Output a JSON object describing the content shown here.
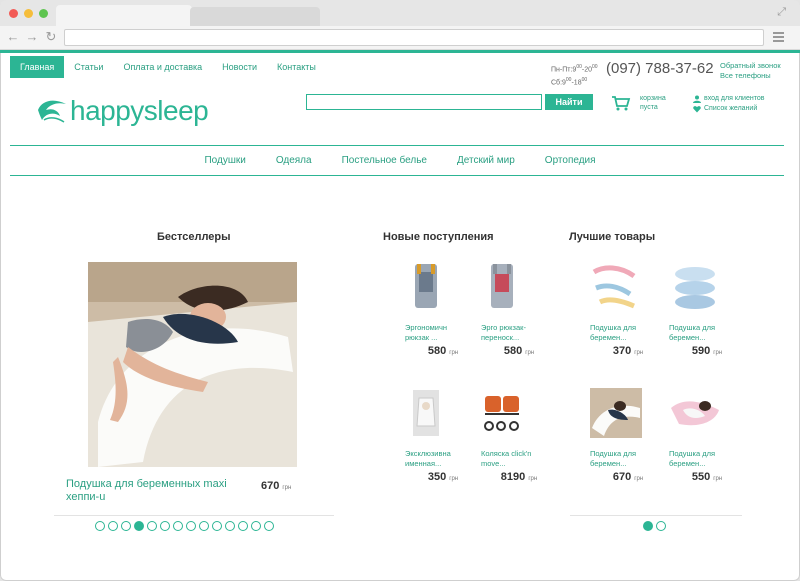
{
  "browser": {
    "colors": {
      "close": "#f25b56",
      "minimize": "#f5bd3a",
      "maximize": "#5ec44f"
    }
  },
  "site": {
    "accent": "#2cb594",
    "topnav": [
      {
        "label": "Главная",
        "active": true
      },
      {
        "label": "Статьи"
      },
      {
        "label": "Оплата и доставка"
      },
      {
        "label": "Новости"
      },
      {
        "label": "Контакты"
      }
    ],
    "hours": {
      "weekdays": "Пн-Пт:9",
      "weekdays_sup1": "00",
      "weekdays_mid": "-20",
      "weekdays_sup2": "00",
      "saturday": "Сб:9",
      "saturday_sup1": "00",
      "saturday_mid": "-18",
      "saturday_sup2": "00"
    },
    "phone": "(097) 788-37-62",
    "callback": "Обратный звонок",
    "all_phones": "Все телефоны",
    "logo": "happysleep",
    "search": {
      "value": "",
      "button": "Найти"
    },
    "cart": {
      "line1": "корзина",
      "line2": "пуста"
    },
    "account": {
      "login": "вход для клиентов",
      "wishlist": "Список желаний"
    },
    "categories": [
      "Подушки",
      "Одеяла",
      "Постельное белье",
      "Детский мир",
      "Ортопедия"
    ]
  },
  "bestsellers": {
    "title": "Бестселлеры",
    "product": {
      "name": "Подушка для беременных maxi хеппи-u",
      "price": "670",
      "currency": "грн"
    },
    "pager_count": 14,
    "pager_active": 3
  },
  "new_arrivals": {
    "title": "Новые поступления",
    "products": [
      {
        "name": "Эргономичн рюкзак ...",
        "price": "580",
        "currency": "грн"
      },
      {
        "name": "Эрго рюкзак-переноск...",
        "price": "580",
        "currency": "грн"
      },
      {
        "name": "Эксклюзивна именная...",
        "price": "350",
        "currency": "грн"
      },
      {
        "name": "Коляска click'n move...",
        "price": "8190",
        "currency": "грн"
      }
    ]
  },
  "best_products": {
    "title": "Лучшие товары",
    "products": [
      {
        "name": "Подушка для беремен...",
        "price": "370",
        "currency": "грн"
      },
      {
        "name": "Подушка для беремен...",
        "price": "590",
        "currency": "грн"
      },
      {
        "name": "Подушка для беремен...",
        "price": "670",
        "currency": "грн"
      },
      {
        "name": "Подушка для беремен...",
        "price": "550",
        "currency": "грн"
      }
    ],
    "pager_count": 2,
    "pager_active": 0
  }
}
